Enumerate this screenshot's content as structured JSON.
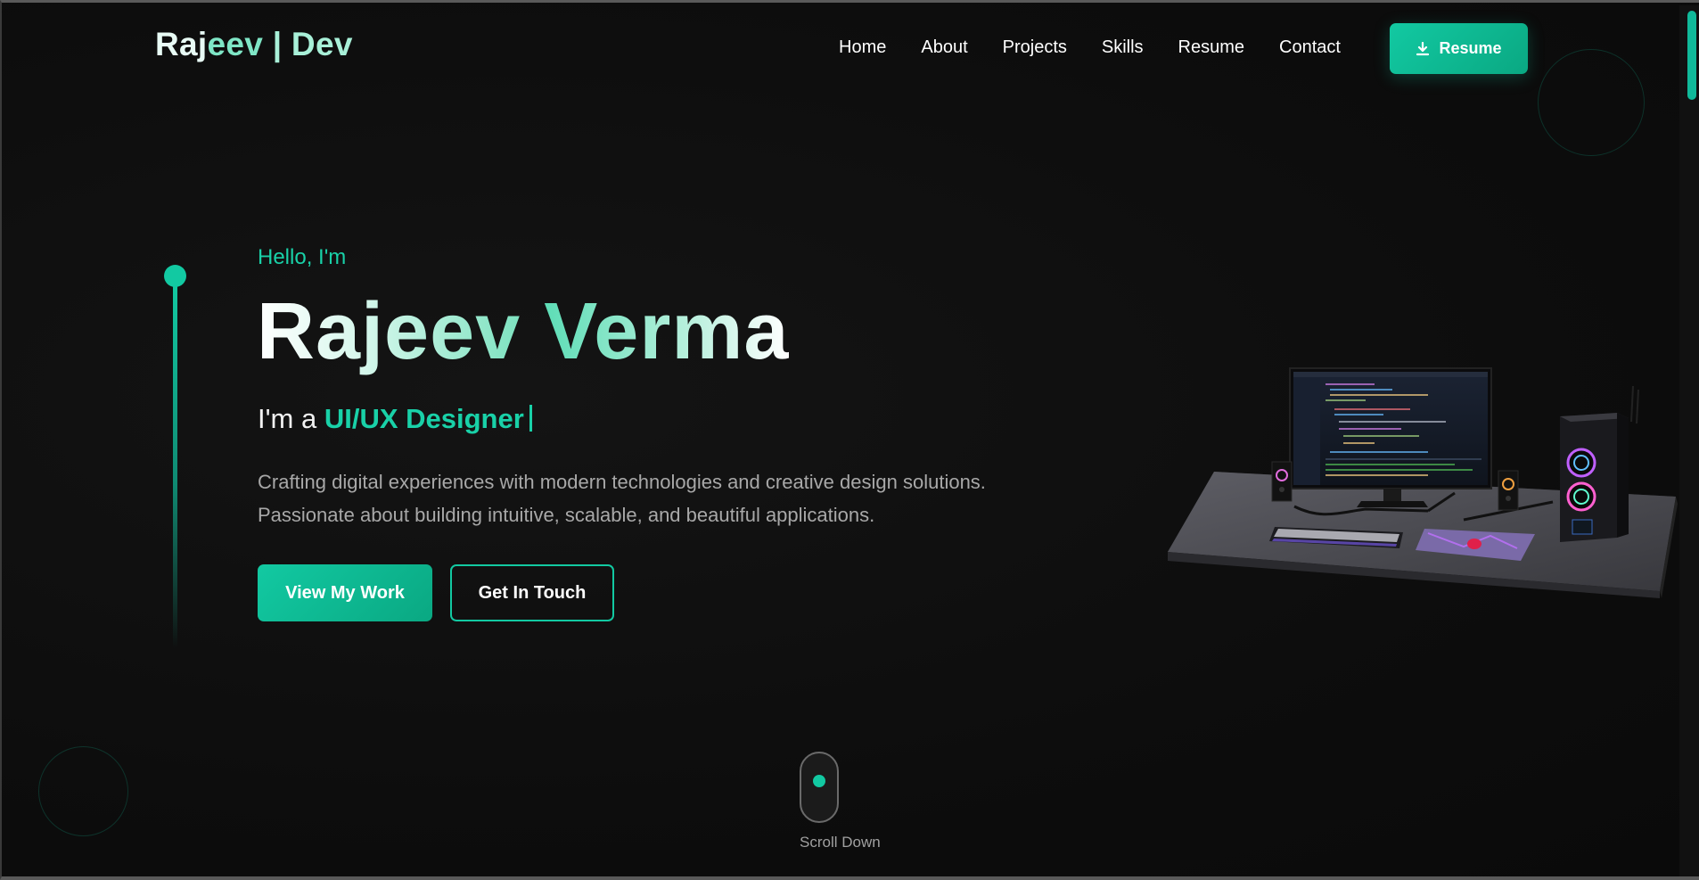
{
  "brand": {
    "part1": "Raj",
    "part2": "eev",
    "part3": " | Dev"
  },
  "nav": {
    "items": [
      "Home",
      "About",
      "Projects",
      "Skills",
      "Resume",
      "Contact"
    ]
  },
  "resume_button": {
    "label": "Resume",
    "icon": "download-icon"
  },
  "hero": {
    "greeting": "Hello, I'm",
    "first_name": "Rajeev",
    "last_name": "Verma",
    "role_prefix": "I'm a ",
    "role": "UI/UX Designer",
    "description_line1": "Crafting digital experiences with modern technologies and creative design solutions.",
    "description_line2": "Passionate about building intuitive, scalable, and beautiful applications.",
    "primary_button": "View My Work",
    "secondary_button": "Get In Touch"
  },
  "scroll": {
    "label": "Scroll Down"
  },
  "colors": {
    "accent": "#12c9a2",
    "background": "#0c0c0c",
    "text_muted": "#a8a8a8"
  }
}
